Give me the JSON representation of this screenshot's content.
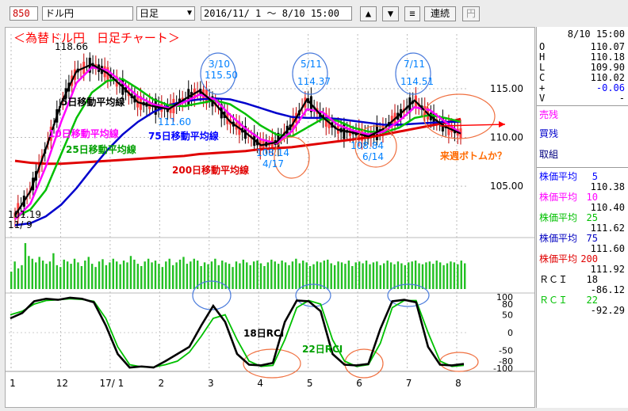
{
  "toolbar": {
    "code": "850",
    "name": "ドル円",
    "period": "日足",
    "date_range": "2016/11/ 1 ～  8/10 15:00",
    "up_label": "▲",
    "down_label": "▼",
    "menu_label": "≡",
    "continuous_label": "連続",
    "yen_label": "円"
  },
  "quote": {
    "datetime": "8/10 15:00",
    "rows": [
      {
        "label": "O",
        "value": "110.07"
      },
      {
        "label": "H",
        "value": "110.18"
      },
      {
        "label": "L",
        "value": "109.90"
      },
      {
        "label": "C",
        "value": "110.02"
      },
      {
        "label": "+",
        "value": "-0.06"
      },
      {
        "label": "V",
        "value": "-"
      }
    ],
    "sell_label": "売残",
    "buy_label": "買残",
    "volume_label": "取組"
  },
  "indicators": [
    {
      "label": "株価平均",
      "period": "5",
      "value": "110.38",
      "color": "#0000ff"
    },
    {
      "label": "株価平均",
      "period": "10",
      "value": "110.40",
      "color": "#ff00ff"
    },
    {
      "label": "株価平均",
      "period": "25",
      "value": "111.62",
      "color": "#00c000"
    },
    {
      "label": "株価平均",
      "period": "75",
      "value": "111.60",
      "color": "#0000c0"
    },
    {
      "label": "株価平均",
      "period": "200",
      "value": "111.92",
      "color": "#e00000"
    }
  ],
  "rci": [
    {
      "label": "ＲＣＩ",
      "period": "18",
      "value": "-86.12",
      "color": "#000000"
    },
    {
      "label": "ＲＣＩ",
      "period": "22",
      "value": "-92.29",
      "color": "#00c000"
    }
  ],
  "chart_data": {
    "type": "line",
    "title": "＜為替ドル円　日足チャート＞",
    "price_axis": {
      "ticks": [
        105.0,
        110.0,
        115.0
      ],
      "labels": [
        "105.00",
        "110.00",
        "115.00"
      ],
      "ylim": [
        100.3,
        120.6
      ]
    },
    "x_ticks": [
      "1",
      "12",
      "17/ 1",
      "2",
      "3",
      "4",
      "5",
      "6",
      "7",
      "8"
    ],
    "ma_labels": [
      {
        "text": "5日移動平均線",
        "color": "#000000"
      },
      {
        "text": "10日移動平均線",
        "color": "#ff00ff"
      },
      {
        "text": "25日移動平均線",
        "color": "#00a000"
      },
      {
        "text": "75日移動平均線",
        "color": "#0000ff"
      },
      {
        "text": "200日移動平均線",
        "color": "#e00000"
      }
    ],
    "price_annotations": [
      {
        "text": "118.66",
        "color": "#000000"
      },
      {
        "text": "101.19",
        "color": "#000000"
      },
      {
        "text": "11/ 9",
        "color": "#000000"
      },
      {
        "text": "3/10",
        "color": "#0080ff"
      },
      {
        "text": "115.50",
        "color": "#0080ff"
      },
      {
        "text": "5/11",
        "color": "#0080ff"
      },
      {
        "text": "114.37",
        "color": "#0080ff"
      },
      {
        "text": "7/11",
        "color": "#0080ff"
      },
      {
        "text": "114.51",
        "color": "#0080ff"
      },
      {
        "text": "111.60",
        "color": "#0080ff"
      },
      {
        "text": "108.14",
        "color": "#0080ff"
      },
      {
        "text": "4/17",
        "color": "#0080ff"
      },
      {
        "text": "108.84",
        "color": "#0080ff"
      },
      {
        "text": "6/14",
        "color": "#0080ff"
      },
      {
        "text": "来週ボトムか？",
        "color": "#ff6a00"
      }
    ],
    "series": [
      {
        "name": "5日移動平均線",
        "color": "#000000",
        "values": [
          102.0,
          104.5,
          108.8,
          113.5,
          116.8,
          117.5,
          116.6,
          115.2,
          113.6,
          113.2,
          112.9,
          113.9,
          114.8,
          113.5,
          111.6,
          110.5,
          109.2,
          109.5,
          111.2,
          113.9,
          112.1,
          110.8,
          110.5,
          110.1,
          110.9,
          112.3,
          113.8,
          112.2,
          111.1,
          110.4
        ]
      },
      {
        "name": "10日移動平均線",
        "color": "#ff00ff",
        "values": [
          101.6,
          103.2,
          107.0,
          111.6,
          115.6,
          117.2,
          116.9,
          115.6,
          114.2,
          113.4,
          113.0,
          113.6,
          114.4,
          113.9,
          112.3,
          110.9,
          109.8,
          109.4,
          110.6,
          112.9,
          112.6,
          111.3,
          110.7,
          110.3,
          110.6,
          111.7,
          113.1,
          112.8,
          111.6,
          110.4
        ]
      },
      {
        "name": "25日移動平均線",
        "color": "#00c000",
        "values": [
          101.8,
          102.6,
          104.6,
          108.3,
          112.0,
          114.6,
          115.8,
          116.0,
          115.0,
          113.9,
          113.3,
          113.2,
          113.5,
          113.8,
          113.4,
          112.4,
          111.2,
          110.3,
          110.1,
          111.0,
          111.9,
          111.7,
          111.0,
          110.6,
          110.5,
          111.0,
          112.0,
          112.3,
          112.0,
          111.6
        ]
      },
      {
        "name": "75日移動平均線",
        "color": "#0000cc",
        "values": [
          101.0,
          101.2,
          101.9,
          103.1,
          104.8,
          106.8,
          108.7,
          110.3,
          111.6,
          112.6,
          113.3,
          113.7,
          113.9,
          114.0,
          113.9,
          113.5,
          113.0,
          112.5,
          112.1,
          112.0,
          112.0,
          111.9,
          111.7,
          111.5,
          111.3,
          111.3,
          111.4,
          111.5,
          111.6,
          111.6
        ]
      },
      {
        "name": "200日移動平均線",
        "color": "#e00000",
        "values": [
          107.6,
          107.4,
          107.3,
          107.3,
          107.4,
          107.5,
          107.6,
          107.7,
          107.8,
          107.9,
          108.0,
          108.1,
          108.3,
          108.4,
          108.5,
          108.6,
          108.8,
          108.9,
          109.0,
          109.2,
          109.4,
          109.6,
          109.8,
          110.0,
          110.3,
          110.6,
          110.9,
          111.2,
          111.5,
          111.9
        ]
      }
    ],
    "volume_values": [
      38,
      60,
      45,
      52,
      100,
      72,
      66,
      58,
      70,
      62,
      55,
      60,
      78,
      52,
      48,
      64,
      60,
      55,
      66,
      58,
      50,
      62,
      70,
      55,
      48,
      60,
      65,
      52,
      58,
      66,
      60,
      54,
      62,
      58,
      72,
      64,
      55,
      50,
      60,
      66,
      58,
      62,
      55,
      48,
      60,
      66,
      52,
      58,
      64,
      70,
      55,
      60,
      66,
      62,
      50,
      58,
      54,
      60,
      66,
      52,
      62,
      58,
      55,
      48,
      60,
      56,
      64,
      58,
      52,
      60,
      62,
      56,
      50,
      58,
      64,
      60,
      55,
      62,
      58,
      52,
      60,
      66,
      56,
      62,
      58,
      50,
      54,
      60,
      58,
      62,
      64,
      56,
      52,
      60,
      58,
      55,
      62,
      50,
      58,
      60,
      56,
      62,
      54,
      58,
      60,
      52,
      56,
      62,
      58,
      54,
      60,
      56,
      52,
      58,
      60,
      62,
      56,
      54,
      58,
      60,
      55,
      62,
      58,
      52,
      56,
      60,
      58,
      54,
      62,
      56
    ],
    "rci_axis": {
      "ticks": [
        100,
        80,
        50,
        0,
        -50,
        -80,
        -100
      ],
      "labels": [
        "100",
        "80",
        "50",
        "0",
        "-50",
        "-80",
        "-100"
      ]
    },
    "rci_labels": [
      {
        "text": "18日RCI",
        "color": "#000000"
      },
      {
        "text": "22日RCI",
        "color": "#00a000"
      }
    ],
    "rci_series": [
      {
        "name": "18日RCI",
        "color": "#000000",
        "values": [
          40,
          55,
          88,
          95,
          92,
          98,
          95,
          85,
          20,
          -60,
          -98,
          -95,
          -98,
          -80,
          -60,
          -40,
          20,
          75,
          30,
          -60,
          -90,
          -92,
          -85,
          30,
          90,
          88,
          60,
          -60,
          -90,
          -92,
          -88,
          10,
          88,
          92,
          85,
          -40,
          -90,
          -92,
          -88
        ]
      },
      {
        "name": "22日RCI",
        "color": "#00c000",
        "values": [
          50,
          60,
          80,
          90,
          92,
          95,
          93,
          88,
          40,
          -40,
          -90,
          -96,
          -97,
          -90,
          -80,
          -55,
          -10,
          40,
          50,
          -20,
          -80,
          -95,
          -92,
          -20,
          70,
          90,
          80,
          -20,
          -80,
          -95,
          -90,
          -30,
          70,
          90,
          90,
          0,
          -80,
          -95,
          -92
        ]
      }
    ]
  }
}
